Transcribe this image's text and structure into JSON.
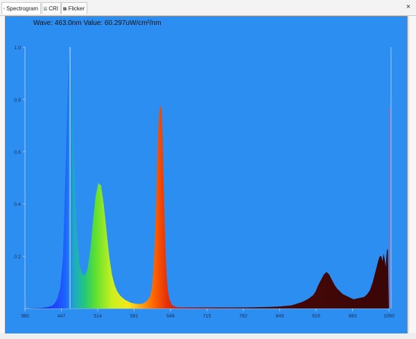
{
  "tabs": [
    {
      "label": "Spectrogram",
      "icon": "spectrogram-icon",
      "active": true
    },
    {
      "label": "CRI",
      "icon": "cri-icon",
      "active": false
    },
    {
      "label": "Flicker",
      "icon": "flicker-icon",
      "active": false
    }
  ],
  "close_label": "×",
  "readout": "Wave: 463.0nm Value: 60.297uW/cm²/nm",
  "colors": {
    "plot_bg": "#2c8ef0",
    "cursor": "#bcd6ff",
    "axis": "#a8c8f0"
  },
  "chart_data": {
    "type": "area",
    "title": "",
    "xlabel": "",
    "ylabel": "",
    "xlim": [
      380,
      1050
    ],
    "ylim": [
      0,
      1.0
    ],
    "xticks": [
      380,
      447,
      514,
      581,
      648,
      715,
      782,
      849,
      916,
      983,
      1050
    ],
    "yticks": [
      0.2,
      0.4,
      0.6,
      0.8,
      1.0
    ],
    "ytick_labels": [
      "0.2",
      "0.4",
      "0.6",
      "0.8",
      "1.0"
    ],
    "cursor_x": 463,
    "series": [
      {
        "x": [
          380,
          410,
          420,
          430,
          435,
          440,
          445,
          450,
          455,
          458,
          460,
          462,
          463,
          465,
          468,
          470,
          473,
          476,
          480,
          485,
          490,
          495,
          500,
          505,
          510,
          515,
          520,
          525,
          530,
          535,
          540,
          545,
          550,
          555,
          560,
          565,
          570,
          575,
          580,
          585,
          590,
          595,
          600,
          605,
          610,
          613,
          616,
          619,
          622,
          625,
          627,
          629,
          631,
          633,
          635,
          637,
          639,
          641,
          643,
          646,
          650,
          655,
          660,
          670,
          690,
          710,
          730,
          750,
          770,
          790,
          810,
          830,
          850,
          870,
          880,
          890,
          900,
          910,
          915,
          920,
          925,
          930,
          935,
          940,
          945,
          950,
          955,
          960,
          965,
          970,
          975,
          980,
          985,
          990,
          995,
          1000,
          1005,
          1010,
          1015,
          1020,
          1025,
          1030,
          1033,
          1036,
          1038,
          1040,
          1042,
          1044,
          1046,
          1048,
          1049,
          1050
        ],
        "y": [
          0.0,
          0.002,
          0.005,
          0.01,
          0.02,
          0.04,
          0.08,
          0.2,
          0.55,
          0.8,
          0.93,
          0.99,
          1.0,
          0.96,
          0.8,
          0.6,
          0.4,
          0.27,
          0.17,
          0.135,
          0.125,
          0.15,
          0.22,
          0.33,
          0.43,
          0.48,
          0.47,
          0.4,
          0.3,
          0.2,
          0.13,
          0.09,
          0.065,
          0.05,
          0.04,
          0.032,
          0.027,
          0.022,
          0.02,
          0.018,
          0.017,
          0.018,
          0.022,
          0.03,
          0.045,
          0.07,
          0.13,
          0.25,
          0.45,
          0.66,
          0.75,
          0.78,
          0.76,
          0.67,
          0.5,
          0.33,
          0.2,
          0.12,
          0.07,
          0.035,
          0.015,
          0.008,
          0.005,
          0.004,
          0.004,
          0.004,
          0.004,
          0.004,
          0.004,
          0.004,
          0.005,
          0.006,
          0.008,
          0.012,
          0.018,
          0.025,
          0.035,
          0.05,
          0.065,
          0.09,
          0.11,
          0.13,
          0.14,
          0.13,
          0.11,
          0.09,
          0.075,
          0.065,
          0.055,
          0.05,
          0.045,
          0.04,
          0.035,
          0.038,
          0.04,
          0.042,
          0.045,
          0.055,
          0.07,
          0.1,
          0.14,
          0.18,
          0.2,
          0.2,
          0.18,
          0.21,
          0.19,
          0.16,
          0.22,
          0.23,
          0.1,
          0.0
        ]
      }
    ]
  }
}
